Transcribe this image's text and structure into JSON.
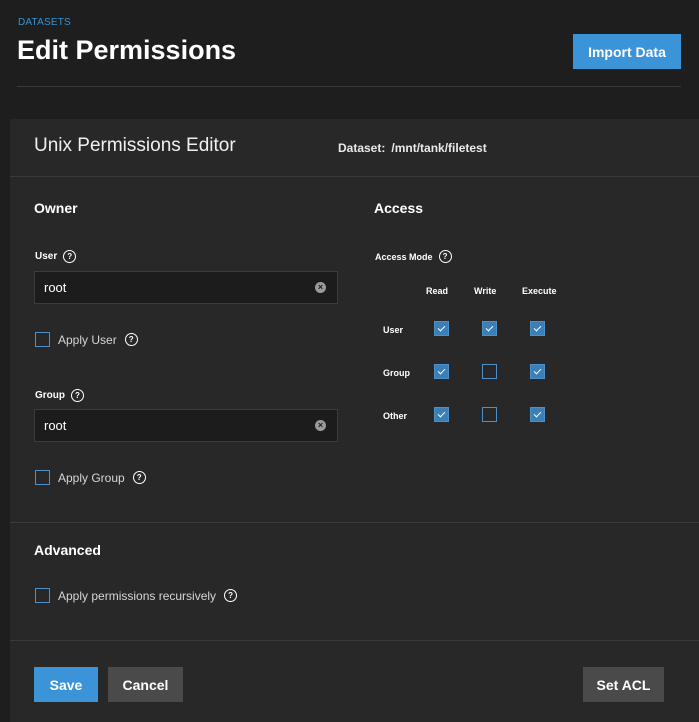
{
  "header": {
    "breadcrumb": "DATASETS",
    "title": "Edit Permissions",
    "import_label": "Import Data"
  },
  "card": {
    "title": "Unix Permissions Editor",
    "dataset_label": "Dataset:",
    "dataset_value": "/mnt/tank/filetest"
  },
  "owner": {
    "title": "Owner",
    "user_label": "User",
    "user_value": "root",
    "apply_user_label": "Apply User",
    "apply_user_checked": false,
    "group_label": "Group",
    "group_value": "root",
    "apply_group_label": "Apply Group",
    "apply_group_checked": false
  },
  "access": {
    "title": "Access",
    "mode_label": "Access Mode",
    "columns": [
      "Read",
      "Write",
      "Execute"
    ],
    "rows": [
      {
        "label": "User",
        "values": [
          true,
          true,
          true
        ]
      },
      {
        "label": "Group",
        "values": [
          true,
          false,
          true
        ]
      },
      {
        "label": "Other",
        "values": [
          true,
          false,
          true
        ]
      }
    ]
  },
  "advanced": {
    "title": "Advanced",
    "recursive_label": "Apply permissions recursively",
    "recursive_checked": false
  },
  "actions": {
    "save_label": "Save",
    "cancel_label": "Cancel",
    "set_acl_label": "Set ACL"
  },
  "colors": {
    "accent": "#3b93d8",
    "background": "#1e1e1e",
    "card": "#282828",
    "secondary_button": "#4a4a4a"
  }
}
